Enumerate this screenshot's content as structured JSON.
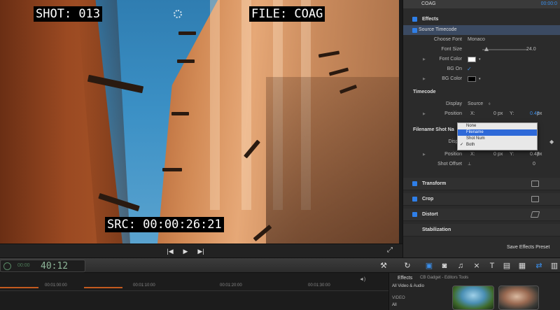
{
  "viewer": {
    "shot_label": "SHOT: 013",
    "file_label": "FILE: COAG",
    "src_label": "SRC: 00:00:26:21"
  },
  "inspector": {
    "clip_name": "COAG",
    "timecode": "00:00:0",
    "effects_label": "Effects",
    "source_timecode_label": "Source Timecode",
    "choose_font_label": "Choose Font",
    "choose_font_value": "Monaco",
    "font_size_label": "Font Size",
    "font_size_value": "24.0",
    "font_color_label": "Font Color",
    "font_color": "#ffffff",
    "bg_on_label": "BG On",
    "bg_color_label": "BG Color",
    "bg_color": "#000000",
    "timecode_section": "Timecode",
    "display_label": "Display",
    "display_value": "Source",
    "position_label": "Position",
    "x_label": "X:",
    "x_value": "0",
    "x_unit": "px",
    "y_label": "Y:",
    "y_value": "0.43",
    "y_unit": "px",
    "filename_section": "Filename Shot Na",
    "display2_label": "Displa",
    "position2_label": "Position",
    "x2_value": "0",
    "x2_unit": "px",
    "y2_value": "0.43",
    "y2_unit": "px",
    "shot_offset_label": "Shot Offset",
    "shot_offset_value": "0",
    "dropdown_options": [
      "None",
      "Filename",
      "Shot Num",
      "Both"
    ],
    "dropdown_checked": "Both",
    "transform_label": "Transform",
    "crop_label": "Crop",
    "distort_label": "Distort",
    "stabilization_label": "Stabilization",
    "save_preset_label": "Save Effects Preset"
  },
  "toolbar": {
    "timecode_small": "00:00",
    "timecode_big": "40:12"
  },
  "timeline": {
    "ruler": [
      "00:01:00:00",
      "00:01:10:00",
      "00:01:20:00",
      "00:01:30:00"
    ]
  },
  "effects": {
    "title": "Effects",
    "category": "CB Gadget - Editors Tools",
    "list": [
      "All Video & Audio",
      "VIDEO",
      "All"
    ]
  },
  "colors": {
    "accent": "#2f7fe8",
    "timecode_green": "#8fb79a",
    "timeline_orange": "#c35a1f"
  }
}
